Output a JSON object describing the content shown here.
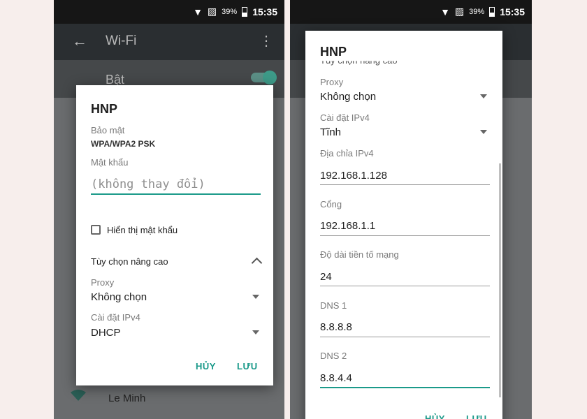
{
  "status_bar": {
    "battery": "39%",
    "time": "15:35"
  },
  "left": {
    "app_bar": {
      "title": "Wi-Fi"
    },
    "wifi_toggle_label": "Bật",
    "network_item": "Le Minh",
    "dialog": {
      "title": "HNP",
      "security_label": "Bảo mật",
      "security_value": "WPA/WPA2 PSK",
      "password_label": "Mật khẩu",
      "password_placeholder": "(không thay đổi)",
      "show_password_label": "Hiển thị mật khẩu",
      "advanced_label": "Tùy chọn nâng cao",
      "proxy_label": "Proxy",
      "proxy_value": "Không chọn",
      "ipv4_label": "Cài đặt IPv4",
      "ipv4_value": "DHCP",
      "cancel": "HỦY",
      "save": "LƯU"
    }
  },
  "right": {
    "dialog": {
      "title": "HNP",
      "advanced_label": "Tùy chọn nâng cao",
      "proxy_label": "Proxy",
      "proxy_value": "Không chọn",
      "ipv4_label": "Cài đặt IPv4",
      "ipv4_value": "Tĩnh",
      "ip_label": "Địa chỉa IPv4",
      "ip_value": "192.168.1.128",
      "gateway_label": "Cổng",
      "gateway_value": "192.168.1.1",
      "prefix_label": "Độ dài tiền tố mạng",
      "prefix_value": "24",
      "dns1_label": "DNS 1",
      "dns1_value": "8.8.8.8",
      "dns2_label": "DNS 2",
      "dns2_value": "8.8.4.4",
      "cancel": "HỦY",
      "save": "LƯU"
    }
  },
  "colors": {
    "accent": "#1b9a8a"
  }
}
